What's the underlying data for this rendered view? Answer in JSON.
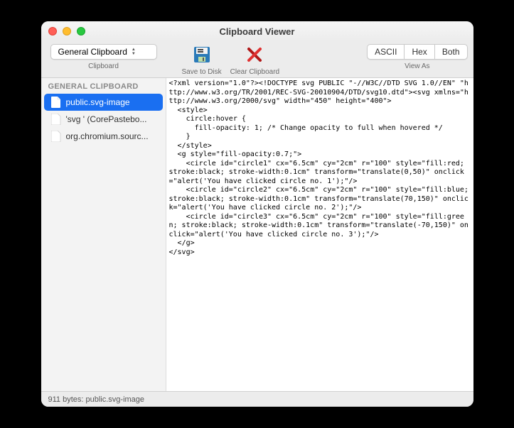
{
  "window": {
    "title": "Clipboard Viewer"
  },
  "toolbar": {
    "clipboard_selector": "General Clipboard",
    "clipboard_label": "Clipboard",
    "save_label": "Save to Disk",
    "clear_label": "Clear Clipboard",
    "view_ascii": "ASCII",
    "view_hex": "Hex",
    "view_both": "Both",
    "view_as_label": "View As"
  },
  "sidebar": {
    "header": "GENERAL CLIPBOARD",
    "items": [
      {
        "label": "public.svg-image",
        "selected": true
      },
      {
        "label": "'svg ' (CorePastebo...",
        "selected": false
      },
      {
        "label": "org.chromium.sourc...",
        "selected": false
      }
    ]
  },
  "content": {
    "text": "<?xml version=\"1.0\"?><!DOCTYPE svg PUBLIC \"-//W3C//DTD SVG 1.0//EN\" \"http://www.w3.org/TR/2001/REC-SVG-20010904/DTD/svg10.dtd\"><svg xmlns=\"http://www.w3.org/2000/svg\" width=\"450\" height=\"400\">\n  <style>\n    circle:hover {\n      fill-opacity: 1; /* Change opacity to full when hovered */\n    }\n  </style>\n  <g style=\"fill-opacity:0.7;\">\n    <circle id=\"circle1\" cx=\"6.5cm\" cy=\"2cm\" r=\"100\" style=\"fill:red; stroke:black; stroke-width:0.1cm\" transform=\"translate(0,50)\" onclick=\"alert('You have clicked circle no. 1');\"/>\n    <circle id=\"circle2\" cx=\"6.5cm\" cy=\"2cm\" r=\"100\" style=\"fill:blue; stroke:black; stroke-width:0.1cm\" transform=\"translate(70,150)\" onclick=\"alert('You have clicked circle no. 2');\"/>\n    <circle id=\"circle3\" cx=\"6.5cm\" cy=\"2cm\" r=\"100\" style=\"fill:green; stroke:black; stroke-width:0.1cm\" transform=\"translate(-70,150)\" onclick=\"alert('You have clicked circle no. 3');\"/>\n  </g>\n</svg>"
  },
  "statusbar": {
    "text": "911 bytes: public.svg-image"
  }
}
